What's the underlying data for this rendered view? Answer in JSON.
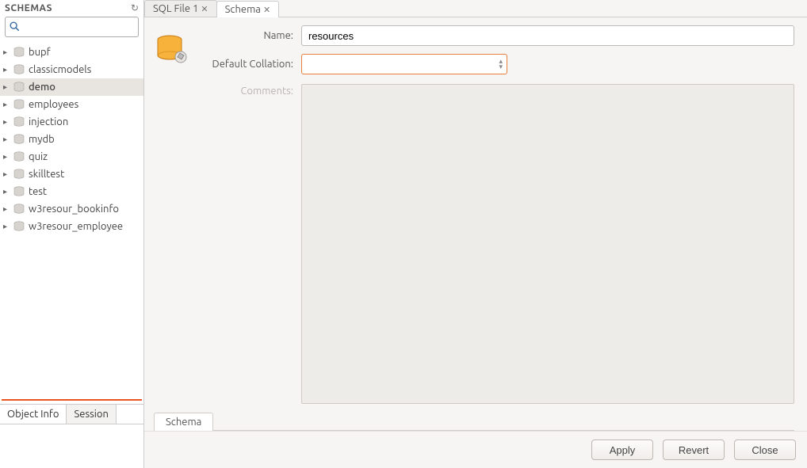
{
  "sidebar": {
    "title": "SCHEMAS",
    "search_value": "",
    "items": [
      {
        "label": "bupf",
        "selected": false
      },
      {
        "label": "classicmodels",
        "selected": false
      },
      {
        "label": "demo",
        "selected": true
      },
      {
        "label": "employees",
        "selected": false
      },
      {
        "label": "injection",
        "selected": false
      },
      {
        "label": "mydb",
        "selected": false
      },
      {
        "label": "quiz",
        "selected": false
      },
      {
        "label": "skilltest",
        "selected": false
      },
      {
        "label": "test",
        "selected": false
      },
      {
        "label": "w3resour_bookinfo",
        "selected": false
      },
      {
        "label": "w3resour_employee",
        "selected": false
      }
    ],
    "bottom_tabs": {
      "object_info": "Object Info",
      "session": "Session"
    }
  },
  "main_tabs": [
    {
      "label": "SQL File 1",
      "active": false
    },
    {
      "label": "Schema",
      "active": true
    }
  ],
  "form": {
    "name_label": "Name:",
    "name_value": "resources",
    "collation_label": "Default Collation:",
    "collation_value": "",
    "comments_label": "Comments:",
    "comments_value": ""
  },
  "sub_tab": "Schema",
  "buttons": {
    "apply": "Apply",
    "revert": "Revert",
    "close": "Close"
  }
}
